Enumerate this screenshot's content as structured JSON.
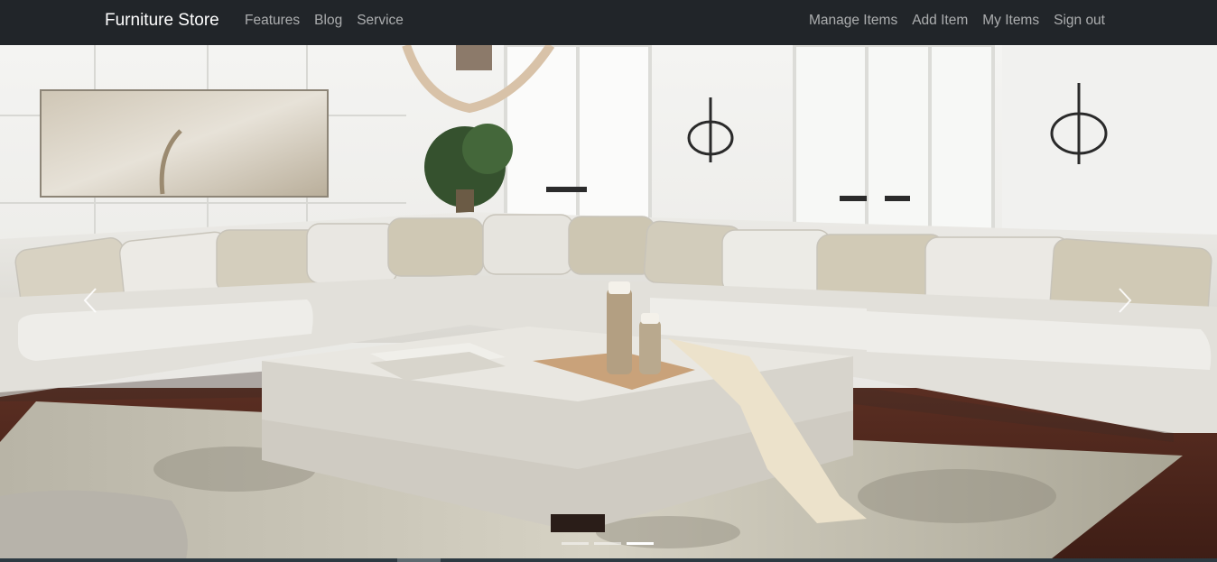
{
  "navbar": {
    "brand": "Furniture Store",
    "left_links": [
      "Features",
      "Blog",
      "Service"
    ],
    "right_links": [
      "Manage Items",
      "Add Item",
      "My Items",
      "Sign out"
    ],
    "background": "#212529"
  },
  "carousel": {
    "slide_count": 3,
    "active_index": 2,
    "prev_icon": "chevron-left-icon",
    "next_icon": "chevron-right-icon"
  }
}
